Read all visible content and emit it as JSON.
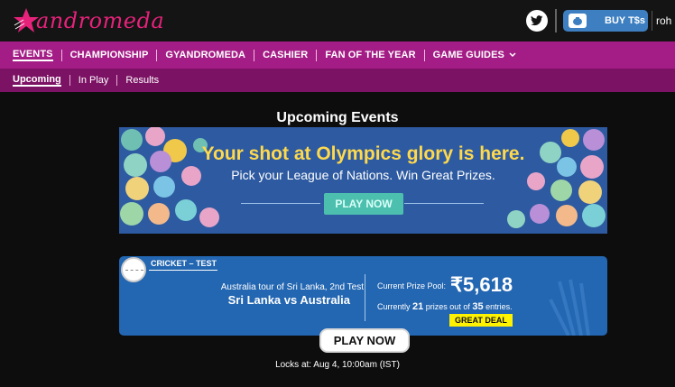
{
  "header": {
    "logo_text": "andromeda",
    "logo_icon": "star-icon",
    "social_icon": "twitter-icon",
    "buy_label": "BUY T$s",
    "buy_icon": "piggy-bank-icon",
    "user_name": "roh"
  },
  "main_nav": [
    "EVENTS",
    "CHAMPIONSHIP",
    "GYANDROMEDA",
    "CASHIER",
    "FAN OF THE YEAR",
    "GAME GUIDES"
  ],
  "main_nav_dropdown_icon": "chevron-down-icon",
  "sub_nav": [
    "Upcoming",
    "In Play",
    "Results"
  ],
  "page_title": "Upcoming Events",
  "banner": {
    "title": "Your shot at Olympics glory is here.",
    "subtitle": "Pick your League of Nations. Win Great Prizes.",
    "button": "PLAY NOW"
  },
  "event": {
    "sport_icon": "cricket-ball-icon",
    "type": "CRICKET – TEST",
    "tour": "Australia tour of Sri Lanka, 2nd Test",
    "match": "Sri Lanka vs Australia",
    "prize_label": "Current Prize Pool:",
    "prize_value": "₹5,618",
    "entries_prefix": "Currently",
    "prizes_count": "21",
    "entries_mid": "prizes out of",
    "entries_count": "35",
    "entries_suffix": "entries.",
    "deal_badge": "GREAT DEAL",
    "play_button": "PLAY NOW",
    "locks_text": "Locks at: Aug 4, 10:00am (IST)"
  },
  "colors": {
    "brand_pink": "#e6227a",
    "main_nav_bg": "#a41c86",
    "sub_nav_bg": "#7c1264",
    "banner_bg": "#2d5aa0",
    "card_bg": "#2366b1",
    "banner_title": "#ffd94d",
    "deal_badge": "#fff200"
  }
}
